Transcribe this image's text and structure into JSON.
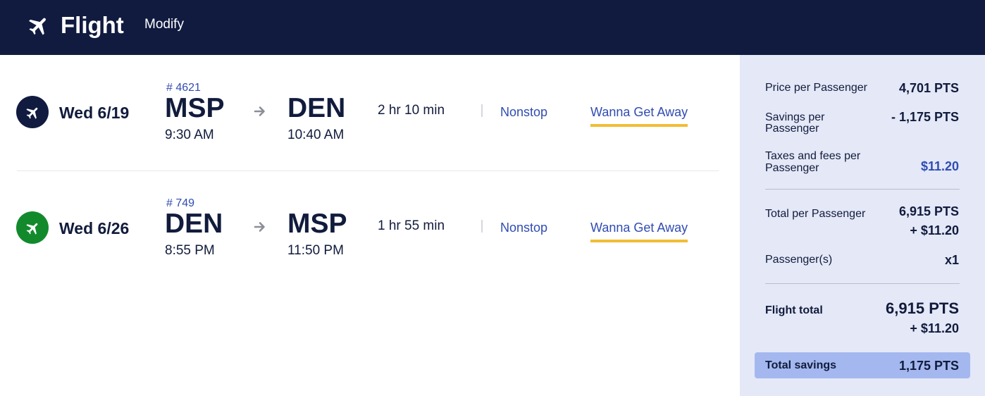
{
  "header": {
    "title": "Flight",
    "modify_label": "Modify"
  },
  "flights": [
    {
      "date": "Wed 6/19",
      "flight_number": "# 4621",
      "origin_code": "MSP",
      "origin_time": "9:30 AM",
      "dest_code": "DEN",
      "dest_time": "10:40 AM",
      "duration": "2 hr 10 min",
      "stops": "Nonstop",
      "fare": "Wanna Get Away",
      "badge_color": "#111b40"
    },
    {
      "date": "Wed 6/26",
      "flight_number": "# 749",
      "origin_code": "DEN",
      "origin_time": "8:55 PM",
      "dest_code": "MSP",
      "dest_time": "11:50 PM",
      "duration": "1 hr 55 min",
      "stops": "Nonstop",
      "fare": "Wanna Get Away",
      "badge_color": "#128a2c"
    }
  ],
  "summary": {
    "price_label": "Price per Passenger",
    "price_value": "4,701 PTS",
    "savings_label_1": "Savings per",
    "savings_label_2": "Passenger",
    "savings_value": "- 1,175 PTS",
    "taxes_label_1": "Taxes and fees per",
    "taxes_label_2": "Passenger",
    "taxes_value": "$11.20",
    "total_pp_label": "Total per Passenger",
    "total_pp_pts": "6,915 PTS",
    "total_pp_cash": "+ $11.20",
    "passengers_label": "Passenger(s)",
    "passengers_value": "x1",
    "flight_total_label": "Flight total",
    "flight_total_pts": "6,915 PTS",
    "flight_total_cash": "+ $11.20",
    "total_savings_label": "Total savings",
    "total_savings_value": "1,175 PTS"
  },
  "colors": {
    "header_bg": "#111b40",
    "link_blue": "#304cb2",
    "fare_underline": "#f2bd35",
    "summary_bg": "#e4e8f7",
    "savings_bar": "#a4b8ef"
  },
  "icons": [
    "plane-icon",
    "arrow-right-icon"
  ]
}
